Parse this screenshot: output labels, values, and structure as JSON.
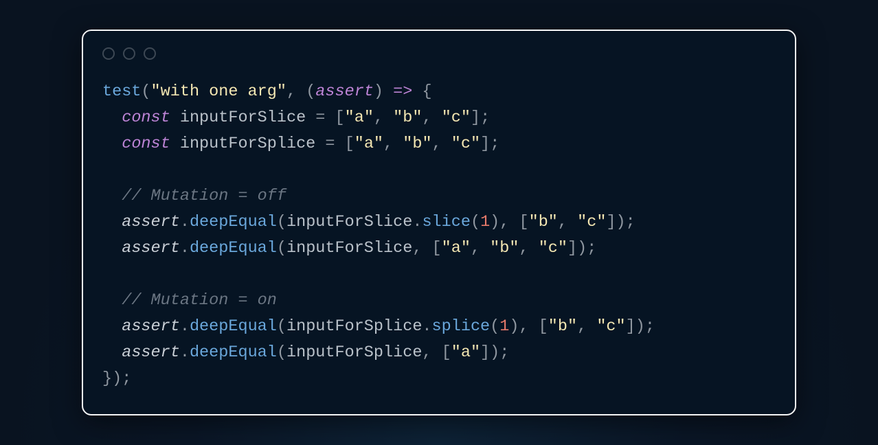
{
  "tokens": [
    [
      [
        "test",
        "t-fn"
      ],
      [
        "(",
        "t-punc"
      ],
      [
        "\"with one arg\"",
        "t-str"
      ],
      [
        ", ",
        "t-punc"
      ],
      [
        "(",
        "t-punc"
      ],
      [
        "assert",
        "t-param"
      ],
      [
        ")",
        "t-punc"
      ],
      [
        " ",
        ""
      ],
      [
        "=>",
        "t-arrow"
      ],
      [
        " ",
        ""
      ],
      [
        "{",
        "t-punc"
      ]
    ],
    [
      [
        "  ",
        ""
      ],
      [
        "const",
        "t-kw"
      ],
      [
        " ",
        ""
      ],
      [
        "inputForSlice",
        "t-id"
      ],
      [
        " ",
        ""
      ],
      [
        "=",
        "t-punc"
      ],
      [
        " ",
        ""
      ],
      [
        "[",
        "t-punc"
      ],
      [
        "\"a\"",
        "t-str"
      ],
      [
        ", ",
        "t-punc"
      ],
      [
        "\"b\"",
        "t-str"
      ],
      [
        ", ",
        "t-punc"
      ],
      [
        "\"c\"",
        "t-str"
      ],
      [
        "];",
        "t-punc"
      ]
    ],
    [
      [
        "  ",
        ""
      ],
      [
        "const",
        "t-kw"
      ],
      [
        " ",
        ""
      ],
      [
        "inputForSplice",
        "t-id"
      ],
      [
        " ",
        ""
      ],
      [
        "=",
        "t-punc"
      ],
      [
        " ",
        ""
      ],
      [
        "[",
        "t-punc"
      ],
      [
        "\"a\"",
        "t-str"
      ],
      [
        ", ",
        "t-punc"
      ],
      [
        "\"b\"",
        "t-str"
      ],
      [
        ", ",
        "t-punc"
      ],
      [
        "\"c\"",
        "t-str"
      ],
      [
        "];",
        "t-punc"
      ]
    ],
    [],
    [
      [
        "  ",
        ""
      ],
      [
        "// Mutation = off",
        "t-com"
      ]
    ],
    [
      [
        "  ",
        ""
      ],
      [
        "assert",
        "t-obj"
      ],
      [
        ".",
        "t-punc"
      ],
      [
        "deepEqual",
        "t-fn"
      ],
      [
        "(",
        "t-punc"
      ],
      [
        "inputForSlice",
        "t-id"
      ],
      [
        ".",
        "t-punc"
      ],
      [
        "slice",
        "t-fn"
      ],
      [
        "(",
        "t-punc"
      ],
      [
        "1",
        "t-num"
      ],
      [
        "), [",
        "t-punc"
      ],
      [
        "\"b\"",
        "t-str"
      ],
      [
        ", ",
        "t-punc"
      ],
      [
        "\"c\"",
        "t-str"
      ],
      [
        "]);",
        "t-punc"
      ]
    ],
    [
      [
        "  ",
        ""
      ],
      [
        "assert",
        "t-obj"
      ],
      [
        ".",
        "t-punc"
      ],
      [
        "deepEqual",
        "t-fn"
      ],
      [
        "(",
        "t-punc"
      ],
      [
        "inputForSlice",
        "t-id"
      ],
      [
        ", [",
        "t-punc"
      ],
      [
        "\"a\"",
        "t-str"
      ],
      [
        ", ",
        "t-punc"
      ],
      [
        "\"b\"",
        "t-str"
      ],
      [
        ", ",
        "t-punc"
      ],
      [
        "\"c\"",
        "t-str"
      ],
      [
        "]);",
        "t-punc"
      ]
    ],
    [],
    [
      [
        "  ",
        ""
      ],
      [
        "// Mutation = on",
        "t-com"
      ]
    ],
    [
      [
        "  ",
        ""
      ],
      [
        "assert",
        "t-obj"
      ],
      [
        ".",
        "t-punc"
      ],
      [
        "deepEqual",
        "t-fn"
      ],
      [
        "(",
        "t-punc"
      ],
      [
        "inputForSplice",
        "t-id"
      ],
      [
        ".",
        "t-punc"
      ],
      [
        "splice",
        "t-fn"
      ],
      [
        "(",
        "t-punc"
      ],
      [
        "1",
        "t-num"
      ],
      [
        "), [",
        "t-punc"
      ],
      [
        "\"b\"",
        "t-str"
      ],
      [
        ", ",
        "t-punc"
      ],
      [
        "\"c\"",
        "t-str"
      ],
      [
        "]);",
        "t-punc"
      ]
    ],
    [
      [
        "  ",
        ""
      ],
      [
        "assert",
        "t-obj"
      ],
      [
        ".",
        "t-punc"
      ],
      [
        "deepEqual",
        "t-fn"
      ],
      [
        "(",
        "t-punc"
      ],
      [
        "inputForSplice",
        "t-id"
      ],
      [
        ", [",
        "t-punc"
      ],
      [
        "\"a\"",
        "t-str"
      ],
      [
        "]);",
        "t-punc"
      ]
    ],
    [
      [
        "});",
        "t-punc"
      ]
    ]
  ]
}
